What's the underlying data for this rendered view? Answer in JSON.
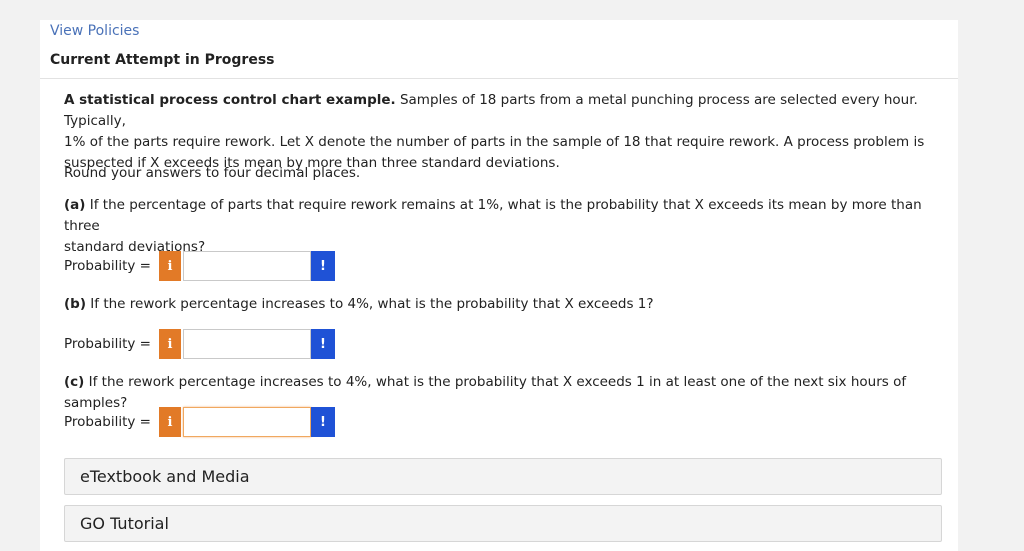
{
  "header": {
    "view_policies": "View Policies",
    "attempt_title": "Current Attempt in Progress"
  },
  "question": {
    "intro_bold": "A statistical process control chart example.",
    "intro_line1": " Samples of 18 parts from a metal punching process are selected every hour. Typically,",
    "intro_line2": "1% of the parts require rework. Let X denote the number of parts in the sample of 18 that require rework. A process problem is",
    "intro_line3": "suspected if X exceeds its mean by more than three standard deviations.",
    "round_note": "Round your answers to four decimal places.",
    "part_a_label": "(a)",
    "part_a_text1": " If the percentage of parts that require rework remains at 1%, what is the probability that X exceeds its mean by more than three",
    "part_a_text2": "standard deviations?",
    "part_b_label": "(b)",
    "part_b_text": " If the rework percentage increases to 4%, what is the probability that X exceeds 1?",
    "part_c_label": "(c)",
    "part_c_text": " If the rework percentage increases to 4%, what is the probability that X exceeds 1 in at least one of the next six hours of samples?"
  },
  "answers": [
    {
      "label": "Probability =",
      "info_icon": "i",
      "value": "",
      "alert_icon": "!"
    },
    {
      "label": "Probability =",
      "info_icon": "i",
      "value": "",
      "alert_icon": "!"
    },
    {
      "label": "Probability =",
      "info_icon": "i",
      "value": "",
      "alert_icon": "!"
    }
  ],
  "resources": {
    "etextbook": "eTextbook and Media",
    "go_tutorial": "GO Tutorial"
  },
  "colors": {
    "link": "#4a72b8",
    "info_button": "#e27a27",
    "alert_button": "#1f52d6"
  }
}
